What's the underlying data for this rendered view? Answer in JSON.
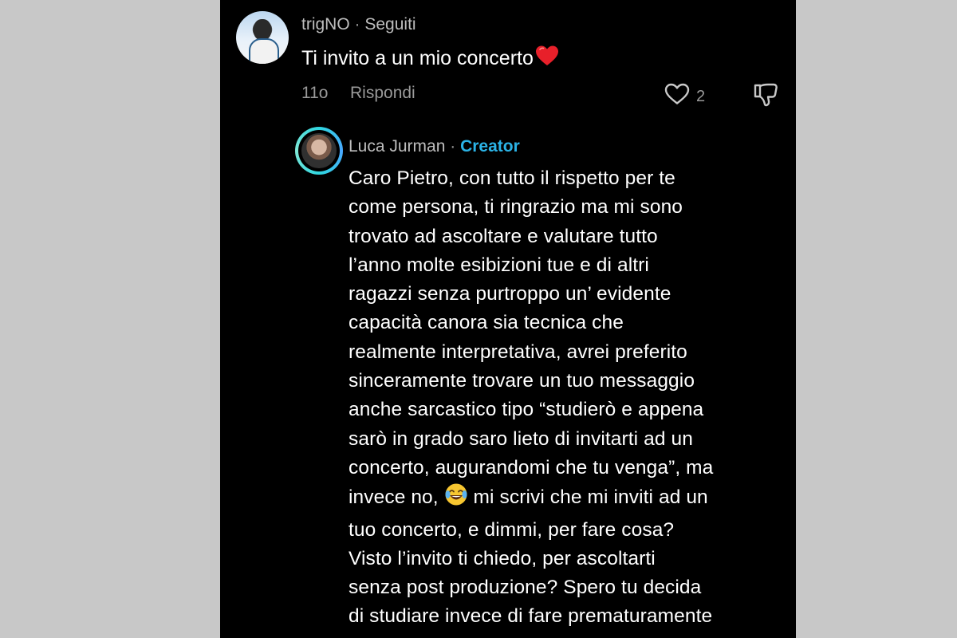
{
  "comment": {
    "username": "trigNO",
    "separator": "·",
    "follow_status": "Seguiti",
    "text": "Ti invito a un mio concerto",
    "text_emoji": "red-heart-emoji",
    "time": "11o",
    "reply_label": "Rispondi",
    "like_count": "2"
  },
  "reply": {
    "username": "Luca Jurman",
    "separator": "·",
    "badge": "Creator",
    "lines": [
      "Caro Pietro, con tutto il rispetto per te",
      "come persona, ti ringrazio ma mi sono",
      "trovato ad ascoltare e valutare tutto",
      "l’anno molte esibizioni tue e di altri",
      "ragazzi senza purtroppo un’ evidente",
      "capacità canora sia tecnica che",
      "realmente interpretativa, avrei preferito",
      "sinceramente trovare un tuo messaggio",
      "anche sarcastico tipo “studierò e appena",
      "sarò in grado saro lieto di invitarti ad un",
      "concerto, augurandomi che tu venga”, ma"
    ],
    "line_with_emoji_before": "invece no,",
    "line_with_emoji_after": "mi scrivi che mi inviti ad un",
    "emoji": "tears-of-joy-emoji",
    "lines_after": [
      "tuo concerto, e dimmi, per fare cosa?",
      "Visto l’invito ti chiedo, per ascoltarti",
      "senza post produzione? Spero tu decida",
      "di studiare invece di fare prematuramente"
    ]
  },
  "colors": {
    "background_outer": "#c8c8c8",
    "background_app": "#000000",
    "text_primary": "#ffffff",
    "text_secondary": "#9a9a9a",
    "creator_badge": "#2bb3e6",
    "heart": "#e8202a"
  }
}
